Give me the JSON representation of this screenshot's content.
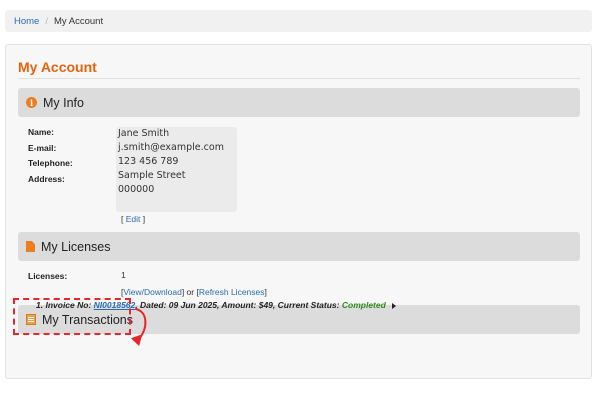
{
  "breadcrumb": {
    "home": "Home",
    "separator": "/",
    "current": "My Account"
  },
  "page": {
    "title": "My Account"
  },
  "my_info": {
    "title": "My Info",
    "icon": "info-icon",
    "labels": {
      "name": "Name:",
      "email": "E-mail:",
      "telephone": "Telephone:",
      "address": "Address:"
    },
    "values": {
      "name": "Jane Smith",
      "email": "j.smith@example.com",
      "telephone": "123 456 789",
      "address_line1": "Sample Street",
      "address_line2": "000000"
    },
    "edit": {
      "open": "[",
      "label": "Edit",
      "close": "]"
    }
  },
  "my_licenses": {
    "title": "My Licenses",
    "icon": "document-icon",
    "licenses_label": "Licenses:",
    "licenses_value": "1",
    "view_download": "View/Download",
    "or_text": "] or [",
    "refresh": "Refresh Licenses",
    "open": "[",
    "close": "]"
  },
  "my_transactions": {
    "title": "My Transactions",
    "icon": "list-icon",
    "items": [
      {
        "index": "1.",
        "invoice_label": "Invoice No:",
        "invoice_no": "NI0018562",
        "dated_label": ", Dated:",
        "dated": "09 Jun 2025",
        "amount_label": ", Amount:",
        "amount": "$49",
        "status_label": ", Current Status:",
        "status": "Completed"
      }
    ]
  },
  "colors": {
    "accent": "#e8620d",
    "link": "#2a6cb0",
    "status_completed": "#2e8b1e",
    "highlight": "#e8252a"
  }
}
